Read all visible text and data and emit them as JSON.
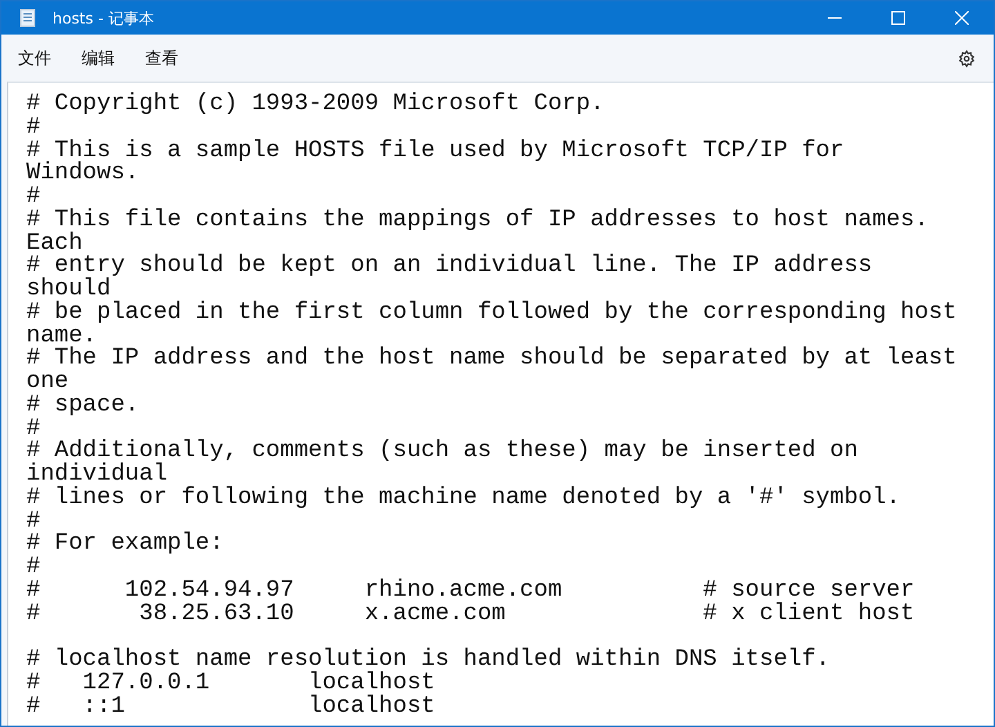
{
  "window": {
    "title": "hosts - 记事本"
  },
  "menu": [
    {
      "label": "文件"
    },
    {
      "label": "编辑"
    },
    {
      "label": "查看"
    }
  ],
  "editor": {
    "lines": [
      {
        "text": "# Copyright (c) 1993-2009 Microsoft Corp."
      },
      {
        "text": "#"
      },
      {
        "text": "# This is a sample HOSTS file used by Microsoft TCP/IP for"
      },
      {
        "text": "Windows."
      },
      {
        "text": "#"
      },
      {
        "text": "# This file contains the mappings of IP addresses to host names."
      },
      {
        "text": "Each"
      },
      {
        "text": "# entry should be kept on an individual line. The IP address"
      },
      {
        "text": "should"
      },
      {
        "text": "# be placed in the first column followed by the corresponding host"
      },
      {
        "text": "name."
      },
      {
        "text": "# The IP address and the host name should be separated by at least"
      },
      {
        "text": "one"
      },
      {
        "text": "# space."
      },
      {
        "text": "#"
      },
      {
        "text": "# Additionally, comments (such as these) may be inserted on"
      },
      {
        "text": "individual"
      },
      {
        "text": "# lines or following the machine name denoted by a '#' symbol."
      },
      {
        "text": "#"
      },
      {
        "text": "# For example:"
      },
      {
        "text": "#"
      },
      {
        "text": "#      102.54.94.97     rhino.acme.com          # source server"
      },
      {
        "text": "#       38.25.63.10     x.acme.com              # x client host"
      },
      {
        "text": "# localhost name resolution is handled within DNS itself.",
        "blank_before": true
      },
      {
        "text": "#   127.0.0.1       localhost"
      },
      {
        "text": "#   ::1             localhost"
      }
    ]
  }
}
